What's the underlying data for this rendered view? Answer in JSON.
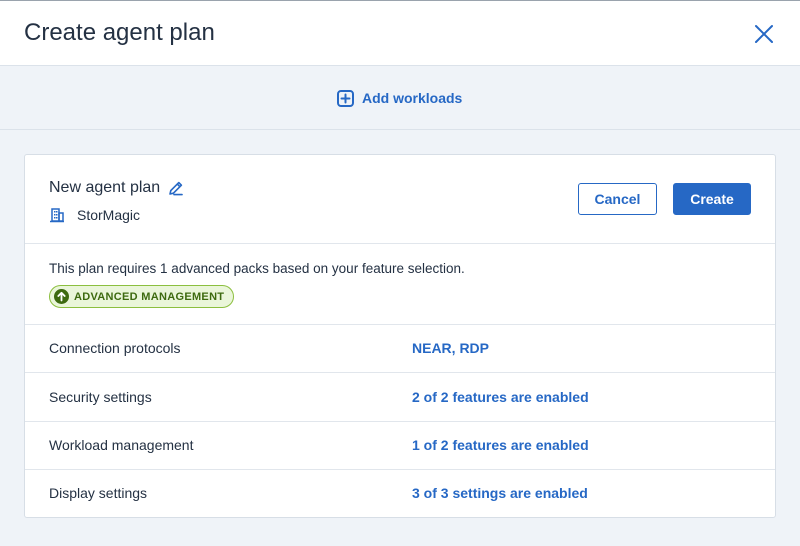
{
  "dialog": {
    "title": "Create agent plan"
  },
  "workloads": {
    "add_label": "Add workloads"
  },
  "plan": {
    "name": "New agent plan",
    "tenant": "StorMagic",
    "cancel_label": "Cancel",
    "create_label": "Create"
  },
  "packs": {
    "message": "This plan requires 1 advanced packs based on your feature selection.",
    "badge": "ADVANCED MANAGEMENT"
  },
  "settings": [
    {
      "label": "Connection protocols",
      "value": "NEAR, RDP"
    },
    {
      "label": "Security settings",
      "value": "2 of 2 features are enabled"
    },
    {
      "label": "Workload management",
      "value": "1 of 2 features are enabled"
    },
    {
      "label": "Display settings",
      "value": "3 of 3 settings are enabled"
    }
  ],
  "colors": {
    "accent": "#2668c5",
    "badge_green": "#3d6a10",
    "text": "#243143"
  }
}
